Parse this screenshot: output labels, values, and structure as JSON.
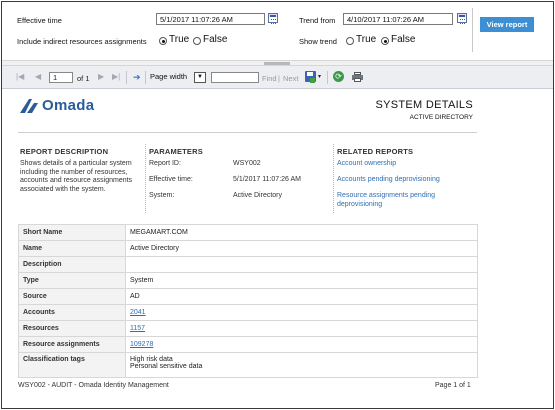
{
  "params": {
    "effective_time_label": "Effective time",
    "effective_time_value": "5/1/2017 11:07:26 AM",
    "trend_from_label": "Trend from",
    "trend_from_value": "4/10/2017 11:07:26 AM",
    "include_indirect_label": "Include indirect resources assignments",
    "include_indirect_selected": "True",
    "show_trend_label": "Show trend",
    "show_trend_selected": "False",
    "true_label": "True",
    "false_label": "False",
    "view_report_label": "View report"
  },
  "toolbar": {
    "page_value": "1",
    "of_text": "of 1",
    "zoom_selected": "Page width",
    "find_label": "Find",
    "separator": "|",
    "next_label": "Next"
  },
  "report": {
    "logo_text": "Omada",
    "title": "SYSTEM DETAILS",
    "subtitle": "ACTIVE DIRECTORY",
    "description_heading": "REPORT DESCRIPTION",
    "description_text": "Shows details of a particular system including the number of resources, accounts and resource assignments associated with the system.",
    "parameters_heading": "PARAMETERS",
    "parameters": [
      {
        "key": "Report ID:",
        "value": "WSY002"
      },
      {
        "key": "Effective time:",
        "value": "5/1/2017 11:07:26 AM"
      },
      {
        "key": "System:",
        "value": "Active Directory"
      }
    ],
    "related_heading": "RELATED REPORTS",
    "related_reports": [
      "Account ownership",
      "Accounts pending deprovisioning",
      "Resource assignments pending deprovisioning"
    ],
    "details": [
      {
        "key": "Short Name",
        "value": "MEGAMART.COM"
      },
      {
        "key": "Name",
        "value": "Active Directory"
      },
      {
        "key": "Description",
        "value": ""
      },
      {
        "key": "Type",
        "value": "System"
      },
      {
        "key": "Source",
        "value": "AD"
      },
      {
        "key": "Accounts",
        "value": "2041"
      },
      {
        "key": "Resources",
        "value": "1157"
      },
      {
        "key": "Resource assignments",
        "value": "109278"
      },
      {
        "key": "Classification tags",
        "value": "High risk data",
        "value2": "Personal sensitive data"
      }
    ],
    "footer_left": "WSY002 - AUDIT - Omada Identity Management",
    "footer_right": "Page 1 of 1"
  },
  "colors": {
    "accent": "#3d8fd3",
    "link": "#2e6fb3",
    "logo": "#2a5c9c"
  }
}
